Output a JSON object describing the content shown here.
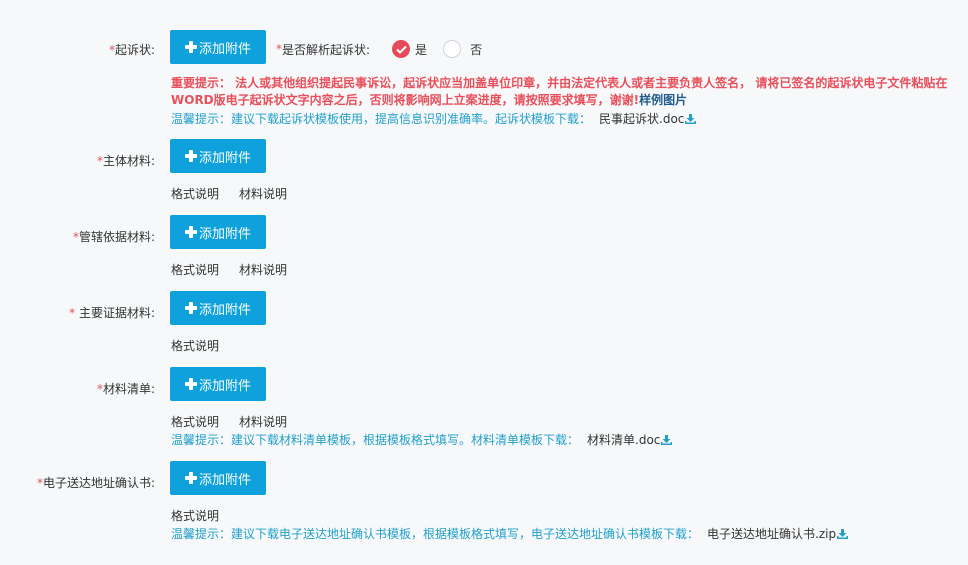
{
  "form": {
    "complaint": {
      "required_mark": "*",
      "label": "起诉状:",
      "button_label": "添加附件",
      "parse_required_mark": "*",
      "parse_label": "是否解析起诉状:",
      "option_yes": "是",
      "option_no": "否",
      "selected": "是",
      "warning_text": "重要提示： 法人或其他组织提起民事诉讼，起诉状应当加盖单位印章，并由法定代表人或者主要负责人签名， 请将已签名的起诉状电子文件粘贴在WORD版电子起诉状文字内容之后，否则将影响网上立案进度，请按照要求填写，谢谢!",
      "sample_link": "样例图片",
      "tip_text": "温馨提示：建议下载起诉状模板使用，提高信息识别准确率。起诉状模板下载：",
      "template_file": "民事起诉状.doc"
    },
    "subject": {
      "required_mark": "*",
      "label": "主体材料:",
      "button_label": "添加附件",
      "link_format": "格式说明",
      "link_material": "材料说明"
    },
    "jurisdiction": {
      "required_mark": "*",
      "label": "管辖依据材料:",
      "button_label": "添加附件",
      "link_format": "格式说明",
      "link_material": "材料说明"
    },
    "evidence": {
      "required_mark": "*",
      "label": " 主要证据材料:",
      "button_label": "添加附件",
      "link_format": "格式说明"
    },
    "material_list": {
      "required_mark": "*",
      "label": "材料清单:",
      "button_label": "添加附件",
      "link_format": "格式说明",
      "link_material": "材料说明",
      "tip_text": "温馨提示：建议下载材料清单模板，根据模板格式填写。材料清单模板下载：",
      "template_file": "材料清单.doc"
    },
    "address_confirm": {
      "required_mark": "*",
      "label": "电子送达地址确认书:",
      "button_label": "添加附件",
      "link_format": "格式说明",
      "tip_text": "温馨提示：建议下载电子送达地址确认书模板，根据模板格式填写，电子送达地址确认书模板下载：",
      "template_file": "电子送达地址确认书.zip"
    }
  },
  "colors": {
    "accent_button": "#0ea1dc",
    "required": "#e8505b",
    "tip": "#22a0c9",
    "radio_selected": "#e64a5a"
  },
  "icons": [
    "plus-icon",
    "download-icon",
    "check-icon"
  ]
}
